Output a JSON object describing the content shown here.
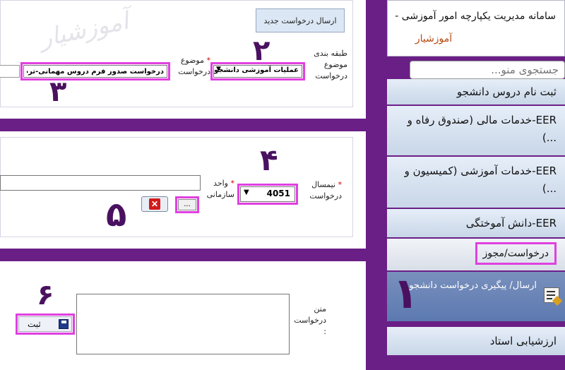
{
  "panel1": {
    "new_request_button": "ارسال درخواست جدید",
    "category_label": "طبقه بندی",
    "topic_label": "موضوع",
    "request_label": "درخواست",
    "category_value": "عملیات آموزشی دانشجو",
    "subject_label": "موضوع",
    "subject_request_label": "درخواست",
    "subject_value": "درخواست صدور فرم دروس مهمانی-ترم کامل",
    "watermark": "آموزشیار"
  },
  "panel2": {
    "semester_label": "نیمسال",
    "semester_request_label": "درخواست",
    "semester_value": "4051",
    "unit_label": "واحد",
    "unit_org_label": "سازمانی",
    "unit_value": "",
    "ellipsis_button": "...",
    "clear_icon": "red-x-icon"
  },
  "panel3": {
    "text_label": "متن",
    "text_request_label": "درخواست",
    "text_colon": ":",
    "text_value": "",
    "submit_label": "ثبت",
    "save_icon": "floppy-disk-icon"
  },
  "sidebar": {
    "title": "سامانه مدیریت یکپارچه امور آموزشی -",
    "subtitle": "آموزشیار",
    "search_placeholder": "جستجوی منو...",
    "items": [
      {
        "label": "ثبت نام دروس دانشجو"
      },
      {
        "label": "EER-خدمات مالی (صندوق رفاه و ...)"
      },
      {
        "label": "EER-خدمات آموزشی (کمیسیون و ...)"
      },
      {
        "label": "EER-دانش آموختگی"
      },
      {
        "label": "درخواست/مجوز"
      }
    ],
    "sub_item": {
      "label": "ارسال/ پیگیری درخواست دانشجو",
      "icon": "document-edit-icon"
    },
    "last_item": {
      "label": "ارزشیابی استاد"
    }
  },
  "step_markers": [
    "۱",
    "۲",
    "۳",
    "۴",
    "۵",
    "۶"
  ],
  "colors": {
    "frame": "#6a1f86",
    "highlight": "#e040e0",
    "marker": "#4a1160",
    "subtitle": "#b54a10"
  }
}
